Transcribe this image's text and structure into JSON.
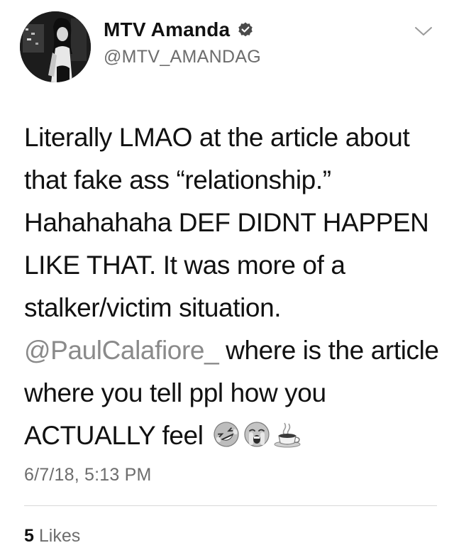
{
  "user": {
    "display_name": "MTV Amanda",
    "handle": "@MTV_AMANDAG",
    "verified": true,
    "verified_icon": "verified-badge-icon",
    "avatar_icon": "profile-photo"
  },
  "menu": {
    "icon": "chevron-down-icon"
  },
  "tweet": {
    "text_part1": "Literally LMAO at the article about that fake ass “relationship.” Hahahahaha DEF DIDNT HAPPEN LIKE THAT. It was more of a stalker/victim situation. ",
    "mention": "@PaulCalafiore_",
    "text_part2": " where is the article where you tell ppl how you ACTUALLY feel",
    "emojis": [
      "rolling-on-floor-laughing-icon",
      "crying-face-icon",
      "hot-beverage-icon"
    ],
    "timestamp": "6/7/18, 5:13 PM"
  },
  "stats": {
    "likes_count": "5",
    "likes_label": "Likes"
  },
  "colors": {
    "text": "#111111",
    "secondary": "#6d6d6d",
    "mention": "#8a8a8a",
    "divider": "#d9d9d9"
  }
}
